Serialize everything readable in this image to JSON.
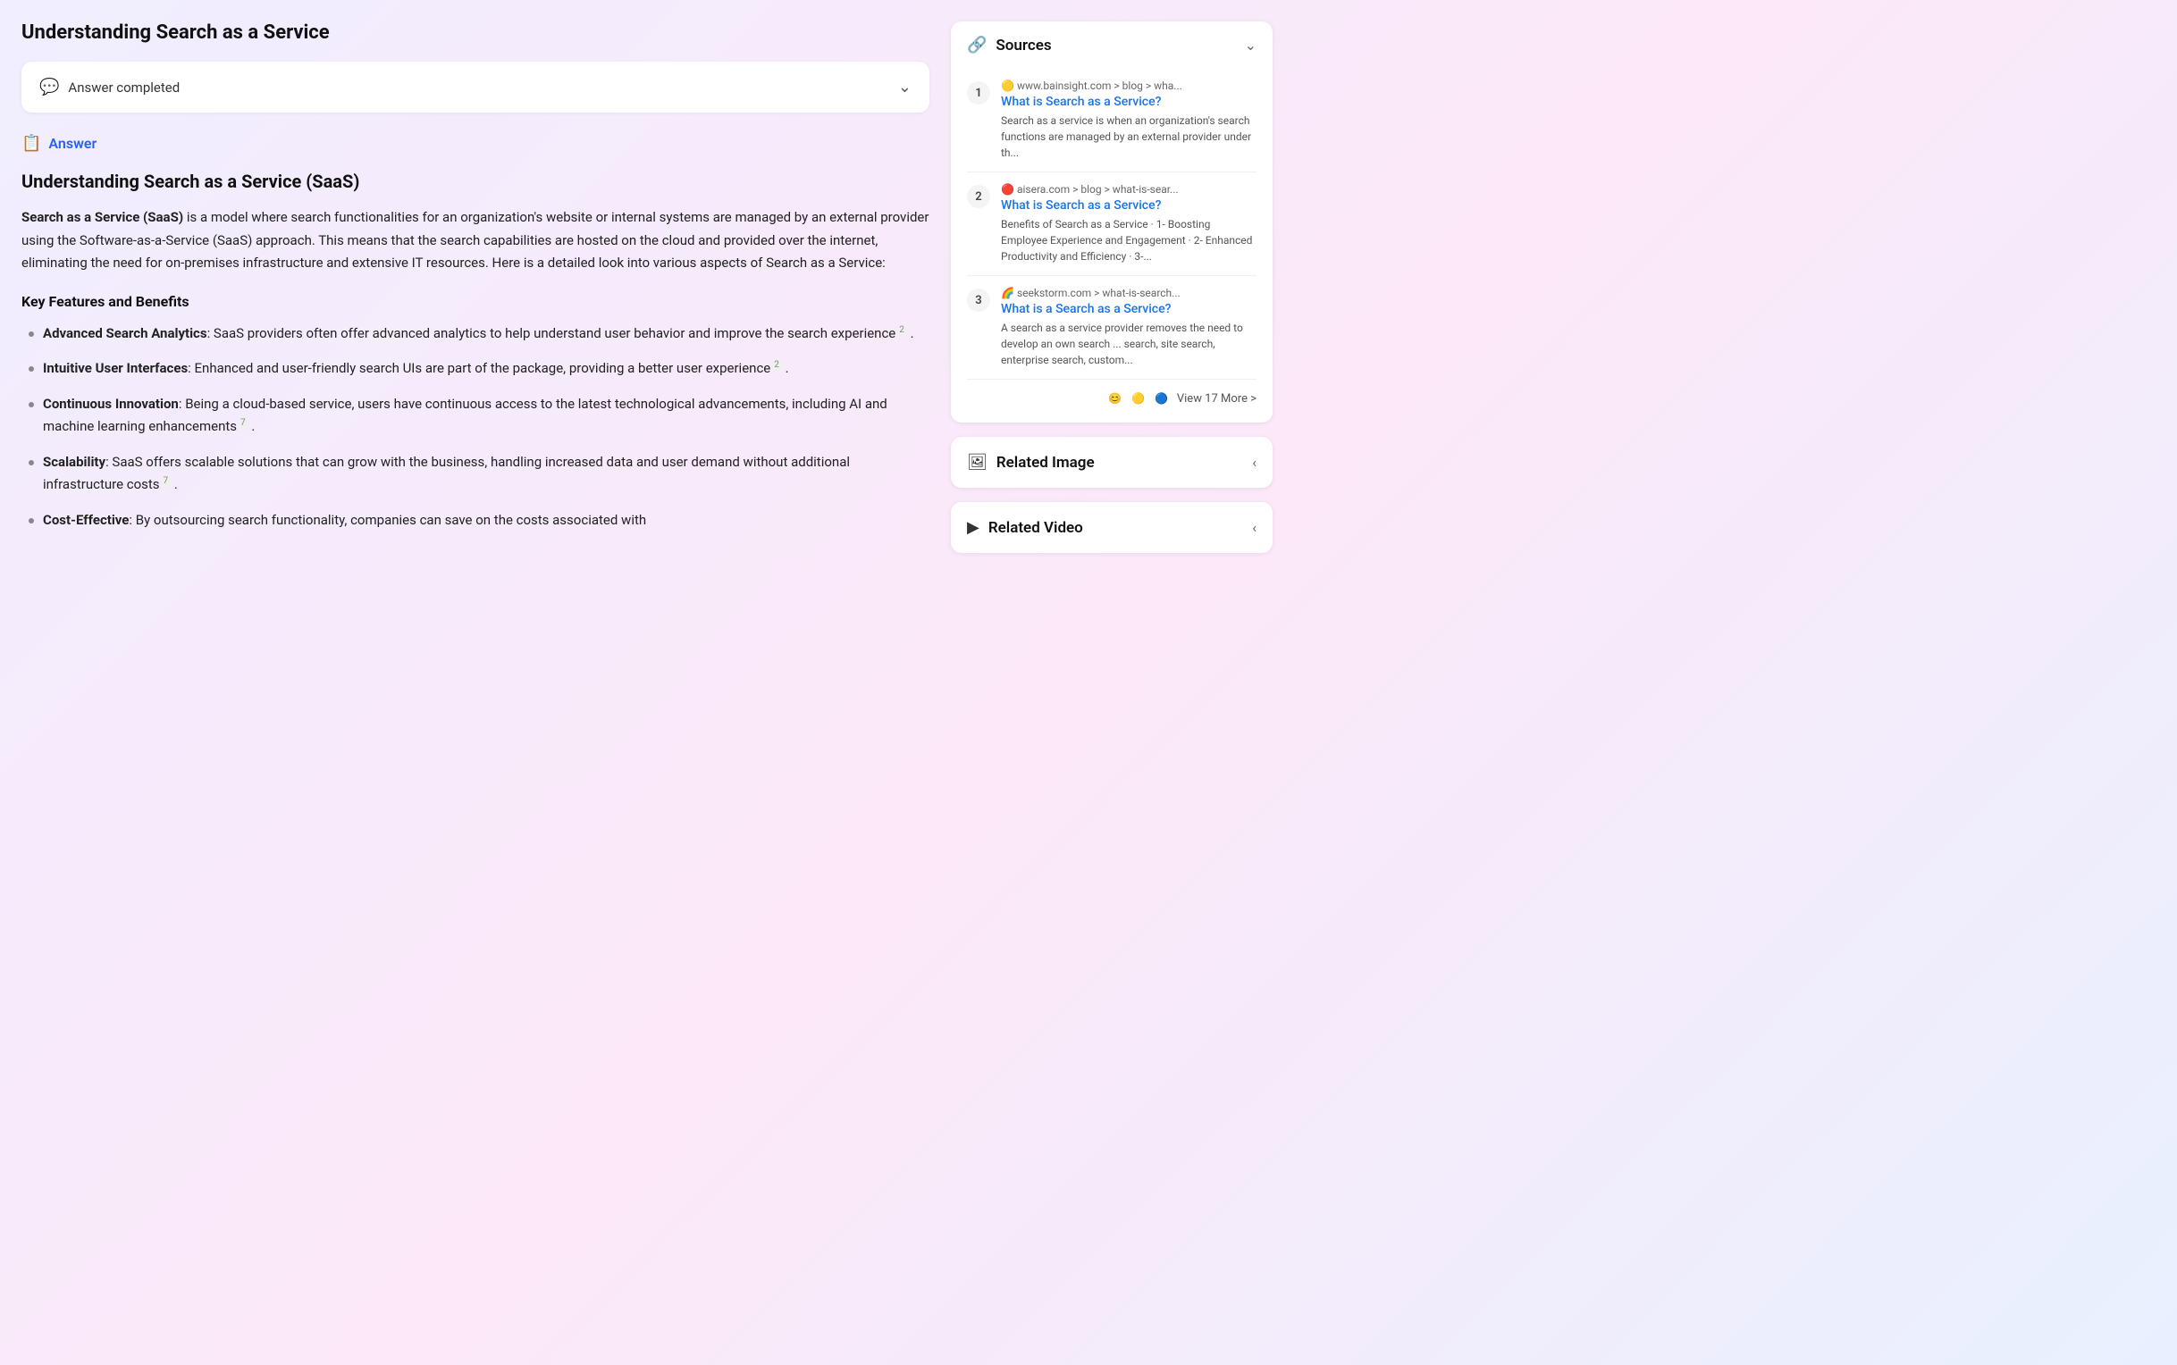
{
  "page": {
    "title": "Understanding Search as a Service"
  },
  "status_card": {
    "icon": "💬",
    "text": "Answer completed"
  },
  "answer_section": {
    "label": "Answer",
    "icon": "📋"
  },
  "article": {
    "title": "Understanding Search as a Service (SaaS)",
    "intro": "Search as a Service (SaaS) is a model where search functionalities for an organization's website or internal systems are managed by an external provider using the Software-as-a-Service (SaaS) approach. This means that the search capabilities are hosted on the cloud and provided over the internet, eliminating the need for on-premises infrastructure and extensive IT resources. Here is a detailed look into various aspects of Search as a Service:",
    "intro_bold": "Search as a Service (SaaS)",
    "key_features_heading": "Key Features and Benefits",
    "bullet_items": [
      {
        "bold": "Advanced Search Analytics",
        "text": ": SaaS providers often offer advanced analytics to help understand user behavior and improve the search experience",
        "sup": "2"
      },
      {
        "bold": "Intuitive User Interfaces",
        "text": ": Enhanced and user-friendly search UIs are part of the package, providing a better user experience",
        "sup": "2"
      },
      {
        "bold": "Continuous Innovation",
        "text": ": Being a cloud-based service, users have continuous access to the latest technological advancements, including AI and machine learning enhancements",
        "sup": "7"
      },
      {
        "bold": "Scalability",
        "text": ": SaaS offers scalable solutions that can grow with the business, handling increased data and user demand without additional infrastructure costs",
        "sup": "7"
      },
      {
        "bold": "Cost-Effective",
        "text": ": By outsourcing search functionality, companies can save on the costs associated with"
      }
    ]
  },
  "sidebar": {
    "sources_title": "Sources",
    "sources": [
      {
        "number": "1",
        "favicon": "🟡",
        "domain": "www.bainsight.com > blog > wha...",
        "link_text": "What is Search as a Service?",
        "snippet": "Search as a service is when an organization's search functions are managed by an external provider under th..."
      },
      {
        "number": "2",
        "favicon": "🔴",
        "domain": "aisera.com > blog > what-is-sear...",
        "link_text": "What is Search as a Service?",
        "snippet": "Benefits of Search as a Service · 1- Boosting Employee Experience and Engagement · 2- Enhanced Productivity and Efficiency · 3-..."
      },
      {
        "number": "3",
        "favicon": "🌈",
        "domain": "seekstorm.com > what-is-search...",
        "link_text": "What is a Search as a Service?",
        "snippet": "A search as a service provider removes the need to develop an own search ... search, site search, enterprise search, custom..."
      }
    ],
    "view_more_label": "View 17 More >",
    "avatars": [
      "😊",
      "🟡",
      "🔵"
    ],
    "related_image_title": "Related Image",
    "related_video_title": "Related Video"
  }
}
